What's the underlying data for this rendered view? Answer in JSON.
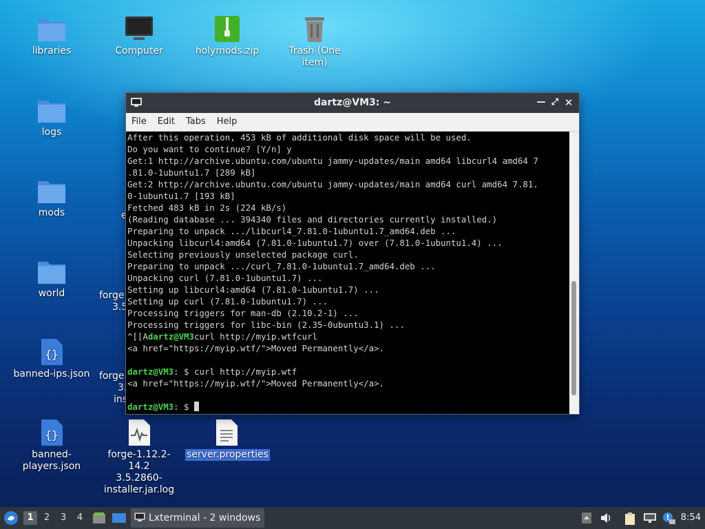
{
  "desktop": {
    "icons": {
      "libraries": "libraries",
      "computer": "Computer",
      "holymods": "holymods.zip",
      "trash": "Trash (One item)",
      "logs": "logs",
      "mods": "mods",
      "world": "world",
      "banned_ips": "banned-ips.json",
      "banned_players_1": "banned-",
      "banned_players_2": "players.json",
      "forge_log_1": "forge-1.12.2-14.2",
      "forge_log_2": "3.5.2860-",
      "forge_log_3": "installer.jar.log",
      "server_properties": "server.properties"
    },
    "partial_labels": {
      "p1": "e",
      "p2a": "forge",
      "p2b": "3.5",
      "p3a": "forge",
      "p3b": "3.",
      "p3c": "ins"
    }
  },
  "terminal": {
    "title": "dartz@VM3: ~",
    "menu": [
      "File",
      "Edit",
      "Tabs",
      "Help"
    ],
    "lines": [
      "After this operation, 453 kB of additional disk space will be used.",
      "Do you want to continue? [Y/n] y",
      "Get:1 http://archive.ubuntu.com/ubuntu jammy-updates/main amd64 libcurl4 amd64 7",
      ".81.0-1ubuntu1.7 [289 kB]",
      "Get:2 http://archive.ubuntu.com/ubuntu jammy-updates/main amd64 curl amd64 7.81.",
      "0-1ubuntu1.7 [193 kB]",
      "Fetched 483 kB in 2s (224 kB/s)",
      "(Reading database ... 394340 files and directories currently installed.)",
      "Preparing to unpack .../libcurl4_7.81.0-1ubuntu1.7_amd64.deb ...",
      "Unpacking libcurl4:amd64 (7.81.0-1ubuntu1.7) over (7.81.0-1ubuntu1.4) ...",
      "Selecting previously unselected package curl.",
      "Preparing to unpack .../curl_7.81.0-1ubuntu1.7_amd64.deb ...",
      "Unpacking curl (7.81.0-1ubuntu1.7) ...",
      "Setting up libcurl4:amd64 (7.81.0-1ubuntu1.7) ...",
      "Setting up curl (7.81.0-1ubuntu1.7) ...",
      "Processing triggers for man-db (2.10.2-1) ...",
      "Processing triggers for libc-bin (2.35-0ubuntu3.1) ..."
    ],
    "prompt1_prefix": "^[[A",
    "prompt_user": "dartz@VM3",
    "prompt1_cmd": "curl http://myip.wtfcurl",
    "output1": "<a href=\"https://myip.wtf/\">Moved Permanently</a>.",
    "prompt_sep": ": $ ",
    "prompt2_cmd": "curl http://myip.wtf",
    "output2": "<a href=\"https://myip.wtf/\">Moved Permanently</a>.",
    "scroll_position": 0.9,
    "scroll_thumb_fraction": 0.42
  },
  "taskbar": {
    "workspaces": [
      "1",
      "2",
      "3",
      "4"
    ],
    "active_workspace": "1",
    "task_label": "Lxterminal - 2 windows",
    "clock": "8:54"
  },
  "colors": {
    "prompt": "#4fd14f",
    "taskbar": "#2f353c",
    "folder": "#5b9be6"
  }
}
